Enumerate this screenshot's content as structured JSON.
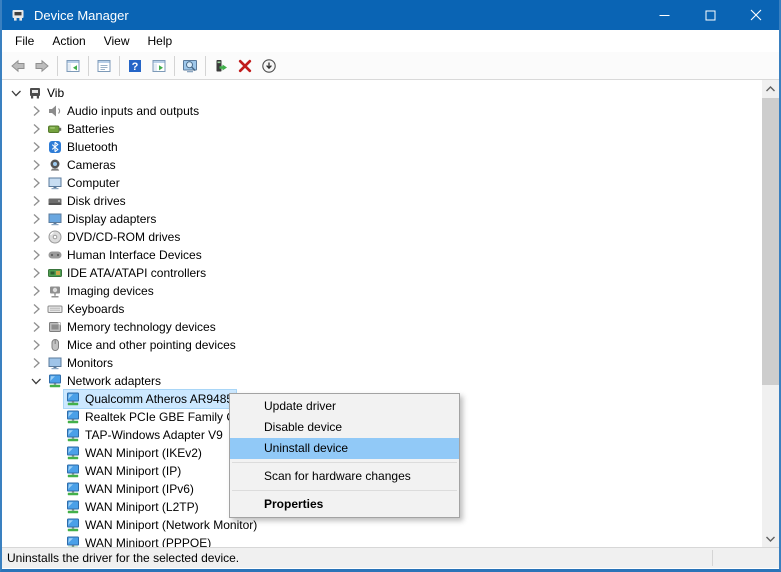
{
  "window": {
    "title": "Device Manager"
  },
  "colors": {
    "titlebar": "#0a64b4",
    "tree_selection": "#cce8ff",
    "menu_highlight": "#91c9f7",
    "uninstall_x": "#c11b1b",
    "update_green": "#3fae49"
  },
  "titlebar_controls": [
    {
      "name": "minimize",
      "icon": "minimize-icon"
    },
    {
      "name": "maximize",
      "icon": "maximize-icon"
    },
    {
      "name": "close",
      "icon": "close-icon"
    }
  ],
  "menubar": {
    "items": [
      "File",
      "Action",
      "View",
      "Help"
    ]
  },
  "toolbar": {
    "buttons": [
      {
        "icon": "back-arrow"
      },
      {
        "icon": "forward-arrow"
      },
      {
        "sep": true
      },
      {
        "icon": "console-tree"
      },
      {
        "sep": true
      },
      {
        "icon": "properties-window"
      },
      {
        "sep": true
      },
      {
        "icon": "help"
      },
      {
        "icon": "standard-panel"
      },
      {
        "sep": true
      },
      {
        "icon": "scan-hardware"
      },
      {
        "sep": true
      },
      {
        "icon": "update-driver"
      },
      {
        "icon": "uninstall-device"
      },
      {
        "icon": "disable-device"
      }
    ]
  },
  "tree": {
    "rows": [
      {
        "label": "Vib",
        "level": 0,
        "chevron": "down",
        "icon": "computer-root"
      },
      {
        "label": "Audio inputs and outputs",
        "level": 1,
        "chevron": "right",
        "icon": "audio"
      },
      {
        "label": "Batteries",
        "level": 1,
        "chevron": "right",
        "icon": "battery"
      },
      {
        "label": "Bluetooth",
        "level": 1,
        "chevron": "right",
        "icon": "bluetooth"
      },
      {
        "label": "Cameras",
        "level": 1,
        "chevron": "right",
        "icon": "camera"
      },
      {
        "label": "Computer",
        "level": 1,
        "chevron": "right",
        "icon": "computer"
      },
      {
        "label": "Disk drives",
        "level": 1,
        "chevron": "right",
        "icon": "disk"
      },
      {
        "label": "Display adapters",
        "level": 1,
        "chevron": "right",
        "icon": "display"
      },
      {
        "label": "DVD/CD-ROM drives",
        "level": 1,
        "chevron": "right",
        "icon": "dvd"
      },
      {
        "label": "Human Interface Devices",
        "level": 1,
        "chevron": "right",
        "icon": "hid"
      },
      {
        "label": "IDE ATA/ATAPI controllers",
        "level": 1,
        "chevron": "right",
        "icon": "ide"
      },
      {
        "label": "Imaging devices",
        "level": 1,
        "chevron": "right",
        "icon": "imaging"
      },
      {
        "label": "Keyboards",
        "level": 1,
        "chevron": "right",
        "icon": "keyboard"
      },
      {
        "label": "Memory technology devices",
        "level": 1,
        "chevron": "right",
        "icon": "memory"
      },
      {
        "label": "Mice and other pointing devices",
        "level": 1,
        "chevron": "right",
        "icon": "mouse"
      },
      {
        "label": "Monitors",
        "level": 1,
        "chevron": "right",
        "icon": "monitor"
      },
      {
        "label": "Network adapters",
        "level": 1,
        "chevron": "down",
        "icon": "network"
      },
      {
        "label": "Qualcomm Atheros AR9485",
        "level": 2,
        "icon": "network",
        "selected": true
      },
      {
        "label": "Realtek PCIe GBE Family Co",
        "level": 2,
        "icon": "network"
      },
      {
        "label": "TAP-Windows Adapter V9",
        "level": 2,
        "icon": "network"
      },
      {
        "label": "WAN Miniport (IKEv2)",
        "level": 2,
        "icon": "network"
      },
      {
        "label": "WAN Miniport (IP)",
        "level": 2,
        "icon": "network"
      },
      {
        "label": "WAN Miniport (IPv6)",
        "level": 2,
        "icon": "network"
      },
      {
        "label": "WAN Miniport (L2TP)",
        "level": 2,
        "icon": "network"
      },
      {
        "label": "WAN Miniport (Network Monitor)",
        "level": 2,
        "icon": "network"
      },
      {
        "label": "WAN Miniport (PPPOE)",
        "level": 2,
        "icon": "network"
      }
    ]
  },
  "context_menu": {
    "items": [
      {
        "type": "item",
        "label": "Update driver"
      },
      {
        "type": "item",
        "label": "Disable device"
      },
      {
        "type": "item",
        "label": "Uninstall device",
        "highlighted": true
      },
      {
        "type": "separator"
      },
      {
        "type": "item",
        "label": "Scan for hardware changes"
      },
      {
        "type": "separator"
      },
      {
        "type": "item",
        "label": "Properties",
        "bold": true
      }
    ]
  },
  "statusbar": {
    "text": "Uninstalls the driver for the selected device."
  }
}
